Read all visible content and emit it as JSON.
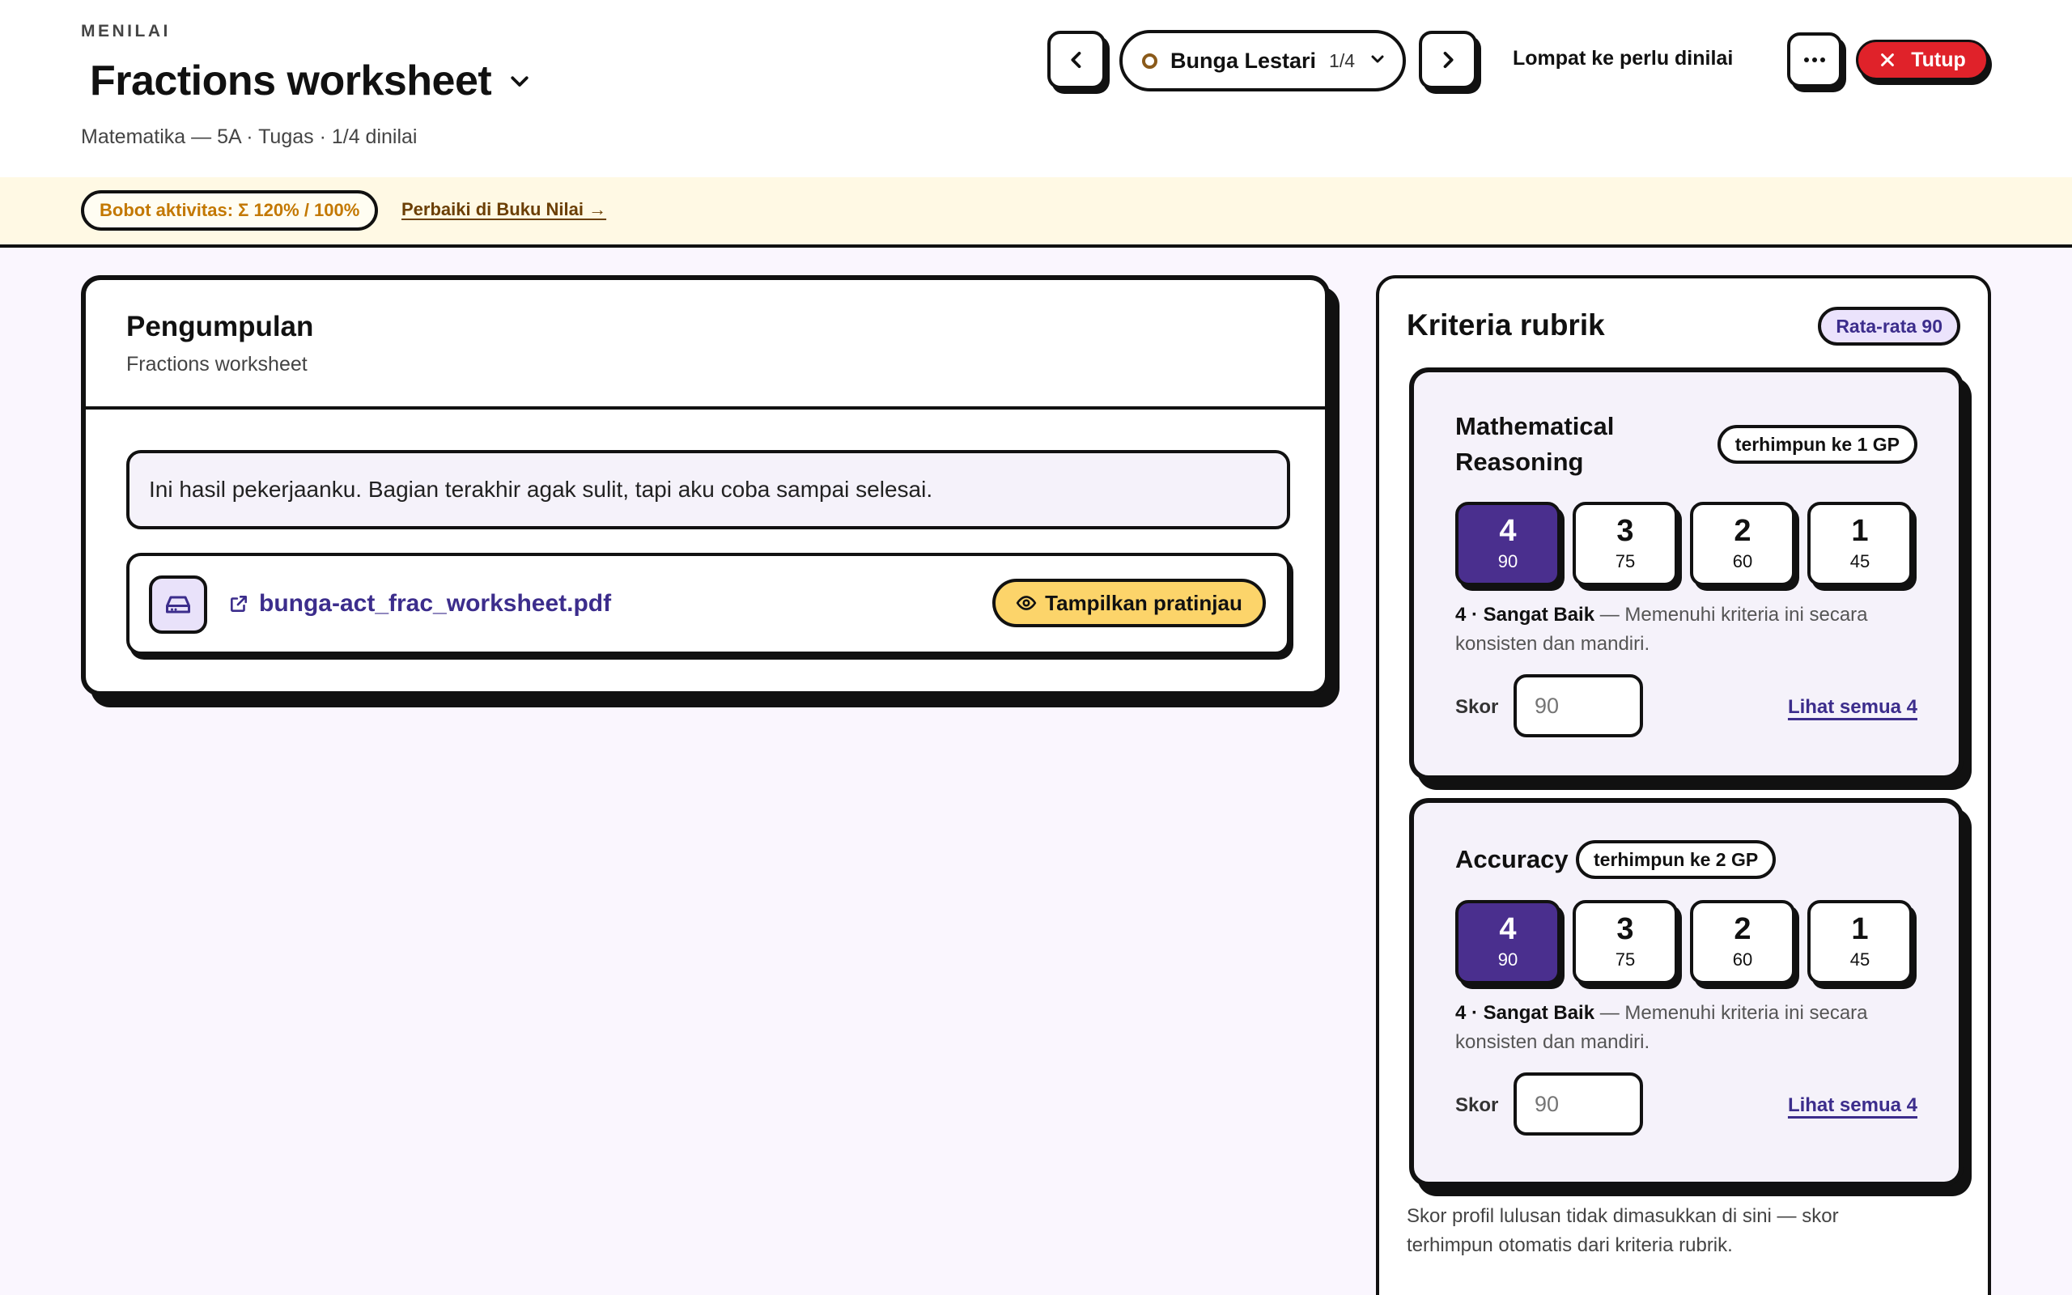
{
  "header": {
    "eyebrow": "MENILAI",
    "title": "Fractions worksheet",
    "subtitle": "Matematika — 5A · Tugas · 1/4 dinilai"
  },
  "nav": {
    "student_name": "Bunga Lestari",
    "student_position": "1/4",
    "skip_label": "Lompat ke perlu dinilai",
    "close_label": "Tutup"
  },
  "banner": {
    "weight_label": "Bobot aktivitas: Σ 120% / 100%",
    "fix_link": "Perbaiki di Buku Nilai →"
  },
  "submission": {
    "title": "Pengumpulan",
    "subtitle": "Fractions worksheet",
    "comment": "Ini hasil pekerjaanku. Bagian terakhir agak sulit, tapi aku coba sampai selesai.",
    "file_name": "bunga-act_frac_worksheet.pdf",
    "preview_label": "Tampilkan pratinjau"
  },
  "rubric": {
    "title": "Kriteria rubrik",
    "average": "Rata-rata 90",
    "criteria": [
      {
        "name": "Mathematical Reasoning",
        "aggregates": "terhimpun ke 1 GP",
        "levels": [
          {
            "level": "4",
            "points": "90",
            "selected": true
          },
          {
            "level": "3",
            "points": "75",
            "selected": false
          },
          {
            "level": "2",
            "points": "60",
            "selected": false
          },
          {
            "level": "1",
            "points": "45",
            "selected": false
          }
        ],
        "selected_title": "4 · Sangat Baik",
        "selected_desc": " — Memenuhi kriteria ini secara konsisten dan mandiri.",
        "score_label": "Skor",
        "score_placeholder": "90",
        "see_all": "Lihat semua 4"
      },
      {
        "name": "Accuracy",
        "aggregates": "terhimpun ke 2 GP",
        "levels": [
          {
            "level": "4",
            "points": "90",
            "selected": true
          },
          {
            "level": "3",
            "points": "75",
            "selected": false
          },
          {
            "level": "2",
            "points": "60",
            "selected": false
          },
          {
            "level": "1",
            "points": "45",
            "selected": false
          }
        ],
        "selected_title": "4 · Sangat Baik",
        "selected_desc": " — Memenuhi kriteria ini secara konsisten dan mandiri.",
        "score_label": "Skor",
        "score_placeholder": "90",
        "see_all": "Lihat semua 4"
      }
    ],
    "footnote": "Skor profil lulusan tidak dimasukkan di sini — skor terhimpun otomatis dari kriteria rubrik."
  },
  "icons": {
    "prev": "chevron-left-icon",
    "next": "chevron-right-icon",
    "dropdown": "chevron-down-icon",
    "more": "more-horizontal-icon",
    "close": "close-icon",
    "file": "drive-icon",
    "external": "external-link-icon",
    "preview": "eye-icon"
  },
  "colors": {
    "accent": "#4a2f8e",
    "link": "#3c2d8c",
    "danger": "#e0222a",
    "warning_text": "#c37800",
    "banner_bg": "#fff9e4",
    "preview_btn": "#fcd46a"
  }
}
